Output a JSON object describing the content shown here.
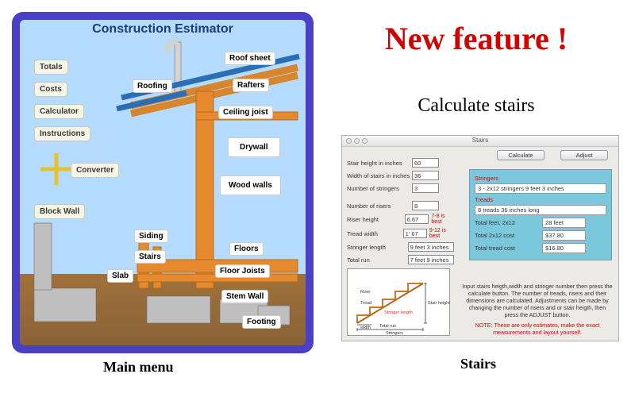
{
  "headline": "New feature !",
  "subhead": "Calculate stairs",
  "captions": {
    "left": "Main menu",
    "right": "Stairs"
  },
  "construction": {
    "title": "Construction Estimator",
    "left_buttons": {
      "totals": "Totals",
      "costs": "Costs",
      "calculator": "Calculator",
      "instructions": "Instructions",
      "converter": "Converter",
      "block_wall": "Block Wall"
    },
    "center_tags": {
      "roofing": "Roofing",
      "siding": "Siding",
      "stairs": "Stairs",
      "slab": "Slab"
    },
    "right_tags": {
      "roof_sheet": "Roof sheet",
      "rafters": "Rafters",
      "ceiling_joist": "Ceiling joist",
      "drywall": "Drywall",
      "wood_walls": "Wood walls",
      "floors": "Floors",
      "floor_joists": "Floor Joists",
      "stem_wall": "Stem Wall",
      "footing": "Footing"
    }
  },
  "stairs": {
    "window_title": "Stairs",
    "buttons": {
      "calculate": "Calculate",
      "adjust": "Adjust"
    },
    "inputs": {
      "stair_height": {
        "label": "Stair height in inches",
        "value": "60"
      },
      "width": {
        "label": "Width of stairs in inches",
        "value": "36"
      },
      "stringers": {
        "label": "Number of stringers",
        "value": "3"
      },
      "risers": {
        "label": "Number of risers",
        "value": "8"
      },
      "riser_height": {
        "label": "Riser height",
        "value": "6.67",
        "tip": "7-8 is best",
        "tip_color": "#d00"
      },
      "tread_width": {
        "label": "Tread width",
        "value": "1' 67",
        "tip": "9-12 is best",
        "tip_color": "#d00"
      },
      "stringer_length": {
        "label": "Stringer length",
        "value": "9 feet  3 inches"
      },
      "total_run": {
        "label": "Total run",
        "value": "7 feet  9 inches"
      }
    },
    "results": {
      "stringers_head": "Stringers",
      "stringers_out": "3 - 2x12  stringers  9 feet  3 inches",
      "treads_head": "Treads",
      "treads_out": "8 treads  36  inches long",
      "total_feet": {
        "label": "Total feet, 2x12",
        "value": "28 feet"
      },
      "cost_2x12": {
        "label": "Total 2x12 cost",
        "value": "$37.80"
      },
      "cost_tread": {
        "label": "Total tread cost",
        "value": "$16.80"
      }
    },
    "diagram_labels": {
      "riser": "Riser",
      "tread": "Tread",
      "stringer_length": "Stringer length",
      "stair_height": "Stair height",
      "total_run": "Total run",
      "width": "width",
      "stringers": "Stringers"
    },
    "description": "Input stairs heigth,width and stringer number then press the calculate button. The number of treads, risers and their dimensions are calculated. Adjustments can be made by changing the number of risers and or stair heigth, then press the ADJUST button.",
    "note": "NOTE: These are only estimates, make the exact measurements and layout yourself."
  }
}
